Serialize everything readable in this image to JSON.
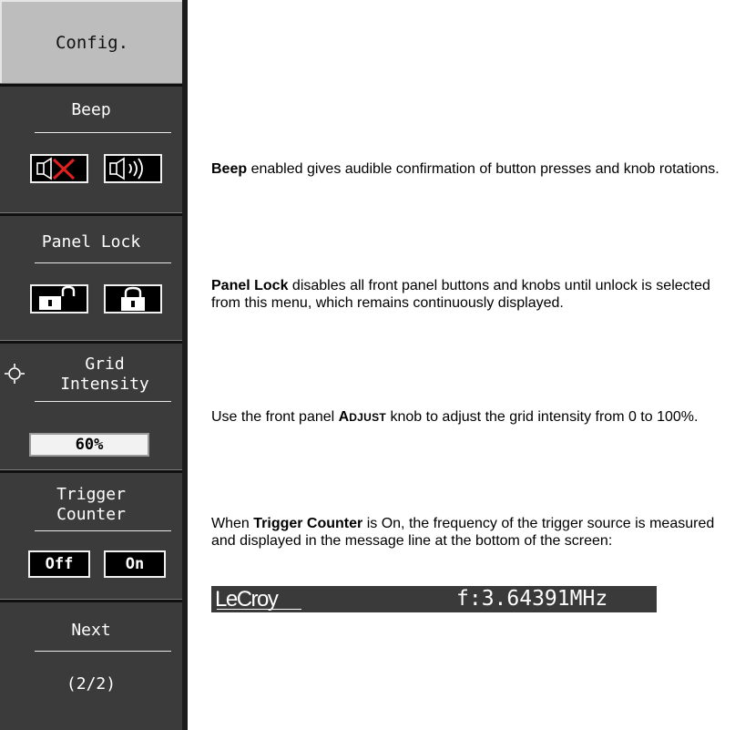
{
  "menu": {
    "title": "Config.",
    "beep": {
      "label": "Beep",
      "options": [
        "beep-off-icon",
        "beep-on-icon"
      ]
    },
    "panel_lock": {
      "label": "Panel Lock",
      "options": [
        "unlocked-icon",
        "locked-icon"
      ]
    },
    "grid_intensity": {
      "label_line1": "Grid",
      "label_line2": "Intensity",
      "icon": "brightness-icon",
      "value": "60%"
    },
    "trigger_counter": {
      "label_line1": "Trigger",
      "label_line2": "Counter",
      "off_label": "Off",
      "on_label": "On"
    },
    "next": {
      "label": "Next",
      "page": "(2/2)"
    }
  },
  "descriptions": {
    "beep": {
      "bold": "Beep",
      "text": " enabled gives audible confirmation of button presses and knob rotations."
    },
    "panel_lock": {
      "bold": "Panel Lock",
      "text": " disables all front panel buttons and knobs until unlock is selected from this menu, which remains continuously displayed."
    },
    "grid_intensity": {
      "pre": "Use the front panel ",
      "smallcaps_first": "A",
      "smallcaps_rest": "DJUST",
      "post": " knob to adjust the grid intensity from 0 to 100%."
    },
    "trigger_counter": {
      "pre": "When ",
      "bold": "Trigger Counter",
      "post": " is On, the frequency of the trigger source is measured and displayed in the message line at the bottom of the screen:"
    }
  },
  "status_line": {
    "brand": "LeCroy",
    "frequency": "f:3.64391MHz"
  },
  "colors": {
    "menu_bg": "#3b3b3b",
    "title_bg": "#bdbdbd",
    "beep_off_x": "#e02020",
    "status_bg": "#3a3a3a"
  }
}
